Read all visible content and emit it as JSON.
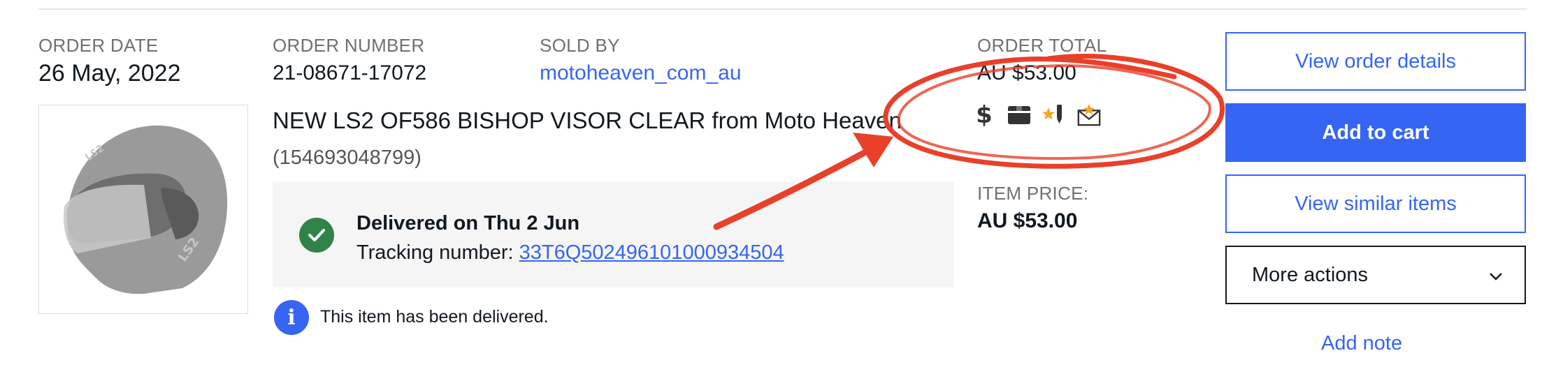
{
  "order": {
    "date_label": "ORDER DATE",
    "date_value": "26 May, 2022",
    "number_label": "ORDER NUMBER",
    "number_value": "21-08671-17072",
    "sold_by_label": "SOLD BY",
    "sold_by_value": "motoheaven_com_au",
    "total_label": "ORDER TOTAL",
    "total_value": "AU $53.00",
    "status_icons": [
      "dollar-icon",
      "package-icon",
      "star-feedback-icon",
      "envelope-star-icon"
    ]
  },
  "item": {
    "title": "NEW LS2 OF586 BISHOP VISOR CLEAR from Moto Heaven",
    "id": "(154693048799)",
    "price_label": "ITEM PRICE:",
    "price_value": "AU $53.00",
    "image_icon": "helmet-icon"
  },
  "delivery": {
    "title": "Delivered on Thu 2 Jun",
    "tracking_prefix": "Tracking number: ",
    "tracking_number": "33T6Q502496101000934504",
    "status_icon": "check-circle-icon"
  },
  "info": {
    "message": "This item has been delivered.",
    "icon": "info-icon",
    "icon_glyph": "i"
  },
  "actions": {
    "view_details": "View order details",
    "add_to_cart": "Add to cart",
    "view_similar": "View similar items",
    "more_actions": "More actions",
    "add_note": "Add note"
  },
  "colors": {
    "accent": "#3665f3",
    "success": "#2f8347",
    "annotation": "#e8402a"
  }
}
